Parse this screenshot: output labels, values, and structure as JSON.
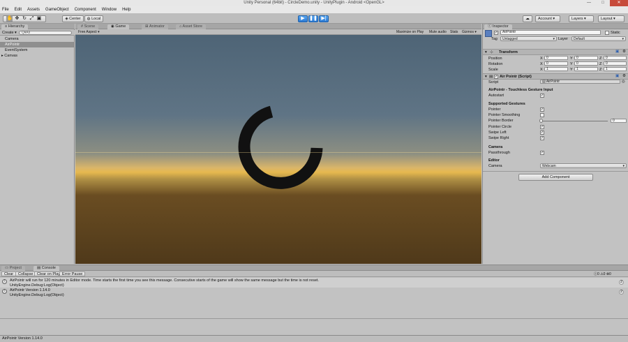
{
  "window": {
    "title": "Unity Personal (64bit) - CircleDemo.unity - UnityPlugin - Android <OpenGL>",
    "controls": [
      "—",
      "□",
      "✕"
    ]
  },
  "menu": [
    "File",
    "Edit",
    "Assets",
    "GameObject",
    "Component",
    "Window",
    "Help"
  ],
  "toolbar": {
    "center_label": "Center",
    "local_label": "Local",
    "account_label": "Account",
    "layers_label": "Layers",
    "layout_label": "Layout"
  },
  "hierarchy": {
    "tab_label": "Hierarchy",
    "create_label": "Create",
    "search_placeholder": "Q▾All",
    "items": [
      "Camera",
      "AirPointr",
      "EventSystem",
      "Canvas"
    ],
    "selected_index": 1
  },
  "scene_tabs": {
    "scene": "Scene",
    "game": "Game",
    "animator": "Animator",
    "asset_store": "Asset Store"
  },
  "game_toolbar": {
    "aspect": "Free Aspect",
    "maximize": "Maximize on Play",
    "mute": "Mute audio",
    "stats": "Stats",
    "gizmos": "Gizmos"
  },
  "inspector": {
    "tab_label": "Inspector",
    "object_name": "AirPointr",
    "static_label": "Static",
    "tag_label": "Tag",
    "tag_value": "Untagged",
    "layer_label": "Layer",
    "layer_value": "Default",
    "transform": {
      "header": "Transform",
      "position_label": "Position",
      "rotation_label": "Rotation",
      "scale_label": "Scale",
      "position": [
        "0",
        "0",
        "0"
      ],
      "rotation": [
        "0",
        "0",
        "0"
      ],
      "scale": [
        "1",
        "1",
        "1"
      ],
      "axis_x": "X",
      "axis_y": "Y",
      "axis_z": "Z"
    },
    "script_component": {
      "header": "Air Pointr (Script)",
      "script_label": "Script",
      "script_value": "AirPointr",
      "section_title": "AirPointr - Touchless Gesture Input",
      "autostart_label": "Autostart",
      "gestures_title": "Supported Gestures",
      "pointer": "Pointer",
      "pointer_smoothing": "Pointer Smoothing",
      "pointer_border": "Pointer Border",
      "pointer_border_value": "0",
      "pointer_circle": "Pointer Circle",
      "swipe_left": "Swipe Left",
      "swipe_right": "Swipe Right",
      "camera_title": "Camera",
      "passthrough": "Passthrough",
      "editor_title": "Editor",
      "camera_label": "Camera",
      "camera_value": "Webcam"
    },
    "add_component": "Add Component"
  },
  "console": {
    "project_tab": "Project",
    "console_tab": "Console",
    "clear": "Clear",
    "collapse": "Collapse",
    "clear_on_play": "Clear on Play",
    "error_pause": "Error Pause",
    "counts": [
      "0",
      "0",
      "0"
    ],
    "messages": [
      {
        "line1": "AirPointr will run for 120 minutes in Editor mode. Time starts the first time you see this message. Consecutive starts of the game will show the same message but the time is not reset.",
        "line2": "UnityEngine.Debug:Log(Object)",
        "count": "2"
      },
      {
        "line1": "AirPointr Version 1.14.0",
        "line2": "UnityEngine.Debug:Log(Object)",
        "count": "2"
      }
    ]
  },
  "status": {
    "text": "AirPointr Version 1.14.0"
  },
  "colors": {
    "play_blue": "#2d7bd4",
    "selected_item": "#8f8f8f",
    "ring": "#111111"
  }
}
